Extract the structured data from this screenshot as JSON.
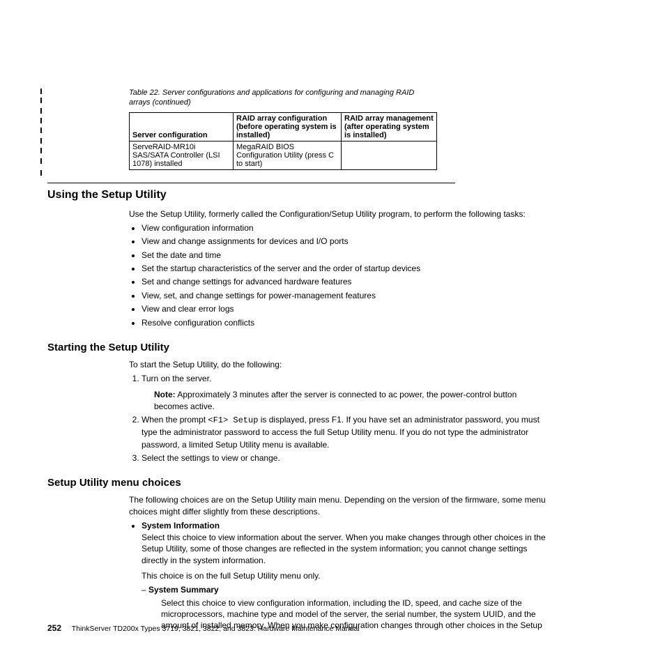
{
  "table": {
    "caption": "Table 22. Server configurations and applications for configuring and managing RAID arrays  (continued)",
    "headers": {
      "col1": "Server configuration",
      "col2": "RAID array configuration (before operating system is installed)",
      "col3": "RAID array management (after operating system is installed)"
    },
    "row": {
      "c1": "ServeRAID-MR10i SAS/SATA Controller (LSI 1078) installed",
      "c2": "MegaRAID BIOS Configuration Utility (press C to start)",
      "c3": ""
    }
  },
  "section1": {
    "heading": "Using the Setup Utility",
    "intro": "Use the Setup Utility, formerly called the Configuration/Setup Utility program, to perform the following tasks:",
    "bullets": [
      "View configuration information",
      "View and change assignments for devices and I/O ports",
      "Set the date and time",
      "Set the startup characteristics of the server and the order of startup devices",
      "Set and change settings for advanced hardware features",
      "View, set, and change settings for power-management features",
      "View and clear error logs",
      "Resolve configuration conflicts"
    ]
  },
  "section2": {
    "heading": "Starting the Setup Utility",
    "intro": "To start the Setup Utility, do the following:",
    "step1": "Turn on the server.",
    "note_label": "Note:",
    "note_body": "Approximately 3 minutes after the server is connected to ac power, the power-control button becomes active.",
    "step2_pre": "When the prompt ",
    "step2_code": "<F1> Setup",
    "step2_post": " is displayed, press F1. If you have set an administrator password, you must type the administrator password to access the full Setup Utility menu. If you do not type the administrator password, a limited Setup Utility menu is available.",
    "step3": "Select the settings to view or change."
  },
  "section3": {
    "heading": "Setup Utility menu choices",
    "intro": "The following choices are on the Setup Utility main menu. Depending on the version of the firmware, some menu choices might differ slightly from these descriptions.",
    "item1_title": "System Information",
    "item1_p1": "Select this choice to view information about the server. When you make changes through other choices in the Setup Utility, some of those changes are reflected in the system information; you cannot change settings directly in the system information.",
    "item1_p2": "This choice is on the full Setup Utility menu only.",
    "sub1_title": "System Summary",
    "sub1_body": "Select this choice to view configuration information, including the ID, speed, and cache size of the microprocessors, machine type and model of the server, the serial number, the system UUID, and the amount of installed memory. When you make configuration changes through other choices in the Setup"
  },
  "footer": {
    "page": "252",
    "text": "ThinkServer TD200x Types 3719, 3821, 3822, and 3823:  Hardware Maintenance Manual"
  }
}
